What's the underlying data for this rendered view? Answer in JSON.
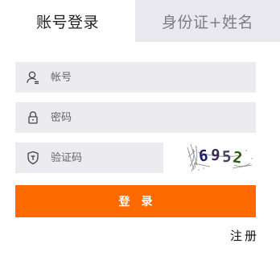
{
  "tabs": [
    {
      "label": "账号登录",
      "active": true
    },
    {
      "label": "身份证+姓名",
      "active": false
    }
  ],
  "form": {
    "account": {
      "placeholder": "帐号",
      "value": "",
      "icon": "user-icon"
    },
    "password": {
      "placeholder": "密码",
      "value": "",
      "icon": "lock-icon"
    },
    "captcha": {
      "placeholder": "验证码",
      "value": "",
      "icon": "shield-icon",
      "image_text": "6952"
    }
  },
  "login_button": {
    "label": "登录"
  },
  "register_link": {
    "label": "注册"
  },
  "colors": {
    "accent": "#ff6a00",
    "tab_inactive_bg": "#e9e8ee",
    "field_bg": "#ebebf0"
  }
}
